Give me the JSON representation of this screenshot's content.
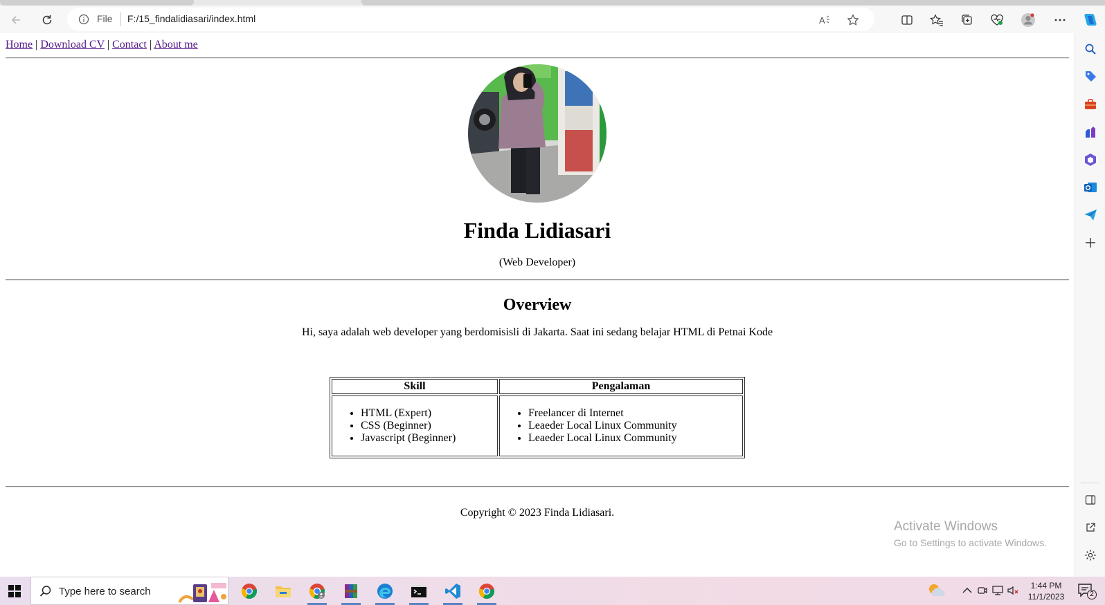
{
  "browser": {
    "address_file_label": "File",
    "url": "F:/15_findalidiasari/index.html",
    "icons": [
      "back-icon",
      "refresh-icon",
      "info-icon",
      "read-aloud-icon",
      "favorite-star-icon",
      "split-screen-icon",
      "favorites-icon",
      "collections-icon",
      "browser-essentials-icon",
      "profile-icon",
      "more-icon",
      "copilot-icon"
    ]
  },
  "sidebar": {
    "items": [
      "search-icon",
      "shopping-icon",
      "tools-icon",
      "games-icon",
      "office-icon",
      "outlook-icon",
      "send-icon",
      "add-icon"
    ],
    "bottom": [
      "sidebar-panel-icon",
      "external-link-icon",
      "settings-icon"
    ]
  },
  "page": {
    "nav": {
      "home": "Home",
      "download_cv": "Download CV",
      "contact": "Contact",
      "about": "About me",
      "separator": "|"
    },
    "name": "Finda Lidiasari",
    "role": "(Web Developer)",
    "overview_title": "Overview",
    "overview_text": "Hi, saya adalah web developer yang berdomisisli di Jakarta. Saat ini sedang belajar HTML di Petnai Kode",
    "table": {
      "headers": [
        "Skill",
        "Pengalaman"
      ],
      "skills": [
        "HTML (Expert)",
        "CSS (Beginner)",
        "Javascript (Beginner)"
      ],
      "experience": [
        "Freelancer di Internet",
        "Leaeder Local Linux Community",
        "Leaeder Local Linux Community"
      ]
    },
    "footer": "Copyright © 2023 Finda Lidiasari."
  },
  "watermark": {
    "line1": "Activate Windows",
    "line2": "Go to Settings to activate Windows."
  },
  "taskbar": {
    "search_placeholder": "Type here to search",
    "apps": [
      "chrome-icon",
      "file-explorer-icon",
      "chrome-profile-icon",
      "winrar-icon",
      "edge-icon",
      "terminal-icon",
      "vscode-icon",
      "chrome-icon"
    ],
    "time": "1:44 PM",
    "date": "11/1/2023",
    "notification_count": "2"
  }
}
